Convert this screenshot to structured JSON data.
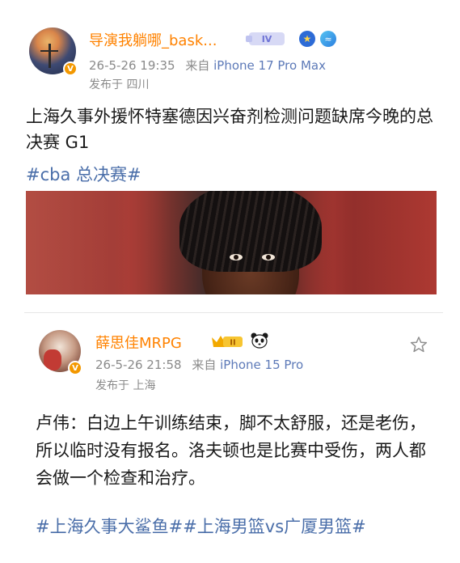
{
  "post1": {
    "username": "导演我躺哪_bask...",
    "level_badge": "IV",
    "timestamp": "26-5-26 19:35",
    "source_prefix": "来自",
    "device": "iPhone 17 Pro Max",
    "location": "发布于 四川",
    "text": "上海久事外援怀特塞德因兴奋剂检测问题缺席今晚的总决赛 G1",
    "hashtag": "#cba 总决赛#"
  },
  "post2": {
    "username": "薛思佳MRPG",
    "level_badge": "II",
    "timestamp": "26-5-26 21:58",
    "source_prefix": "来自",
    "device": "iPhone 15 Pro",
    "location": "发布于 上海",
    "text": "卢伟：白边上午训练结束，脚不太舒服，还是老伤，所以临时没有报名。洛夫顿也是比赛中受伤，两人都会做一个检查和治疗。",
    "hashtags": "#上海久事大鲨鱼##上海男篮vs广厦男篮#"
  },
  "icons": {
    "verified": "verified-v-icon",
    "star": "star-outline-icon",
    "panda": "panda-icon",
    "crown": "crown-icon"
  },
  "colors": {
    "username": "#ff8200",
    "hashtag": "#4a6ea9",
    "meta": "#8a8a8a",
    "device": "#5d7ab8"
  }
}
